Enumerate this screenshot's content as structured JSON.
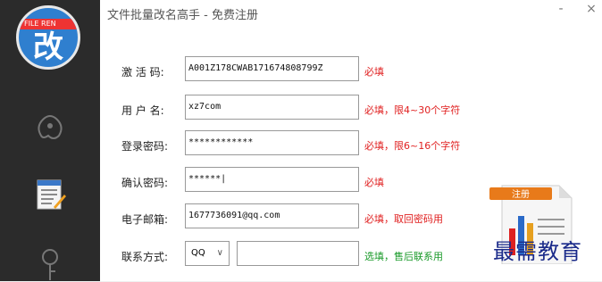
{
  "window": {
    "title": "文件批量改名高手  -  免费注册",
    "minimize": "-",
    "close": "×"
  },
  "logo": {
    "banner": "FILE REN",
    "glyph": "改"
  },
  "form": {
    "activation": {
      "label": "激 活 码:",
      "value": "A001Z178CWAB171674808799Z",
      "hint": "必填"
    },
    "username": {
      "label": "用 户 名:",
      "value": "xz7com",
      "hint": "必填，限4~30个字符"
    },
    "password": {
      "label": "登录密码:",
      "value": "************",
      "hint": "必填，限6~16个字符"
    },
    "confirm": {
      "label": "确认密码:",
      "value": "******|",
      "hint": "必填"
    },
    "email": {
      "label": "电子邮箱:",
      "value": "1677736091@qq.com",
      "hint": "必填，取回密码用"
    },
    "contact": {
      "label": "联系方式:",
      "type_selected": "QQ",
      "value": "",
      "hint": "选填，售后联系用"
    }
  },
  "register_badge": "注册",
  "watermark": "最需教育",
  "colors": {
    "sidebar": "#2b2b2b",
    "required_hint": "#e02020",
    "optional_hint": "#1a9a2a"
  }
}
